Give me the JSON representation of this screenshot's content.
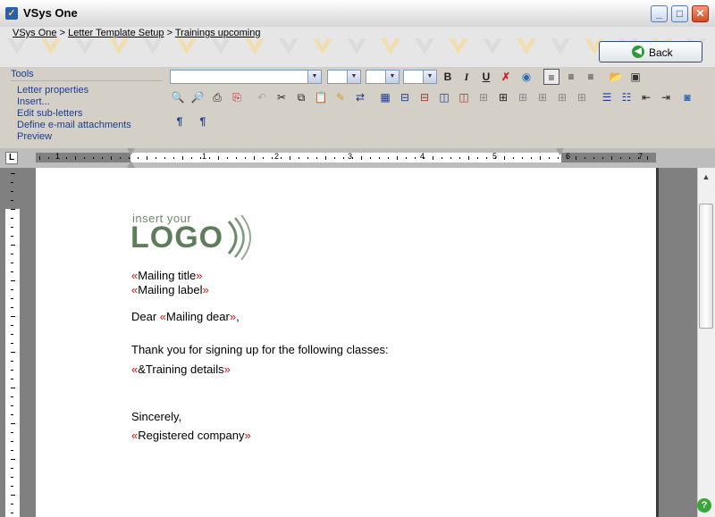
{
  "window": {
    "title": "VSys One"
  },
  "breadcrumb": [
    {
      "label": "VSys One"
    },
    {
      "label": "Letter Template Setup"
    },
    {
      "label": "Trainings upcoming"
    }
  ],
  "breadcrumb_separator": ">",
  "back_button": {
    "label": "Back"
  },
  "tools": {
    "heading": "Tools",
    "items": [
      {
        "label": "Letter properties"
      },
      {
        "label": "Insert..."
      },
      {
        "label": "Edit sub-letters"
      },
      {
        "label": "Define e-mail attachments"
      },
      {
        "label": "Preview"
      }
    ]
  },
  "toolbar": {
    "bold": "B",
    "italic": "I",
    "underline": "U",
    "pilcrow": "¶"
  },
  "ruler": {
    "corner": "L",
    "numbers": [
      "1",
      "1",
      "2",
      "3",
      "4",
      "5",
      "6",
      "7"
    ]
  },
  "logo": {
    "line1": "insert your",
    "line2": "LOGO"
  },
  "letter": {
    "open_mark": "«",
    "close_mark": "»",
    "mailing_title": "Mailing title",
    "mailing_label": "Mailing label",
    "dear_prefix": "Dear ",
    "mailing_dear": "Mailing dear",
    "dear_suffix": ",",
    "body": "Thank you for signing up for the following classes:",
    "training_details": "&Training details",
    "closing": "Sincerely,",
    "registered_company": "Registered company"
  },
  "colors": {
    "merge_field": "#cc1111",
    "link": "#1a3d8a",
    "logo": "#5f7d5c"
  }
}
